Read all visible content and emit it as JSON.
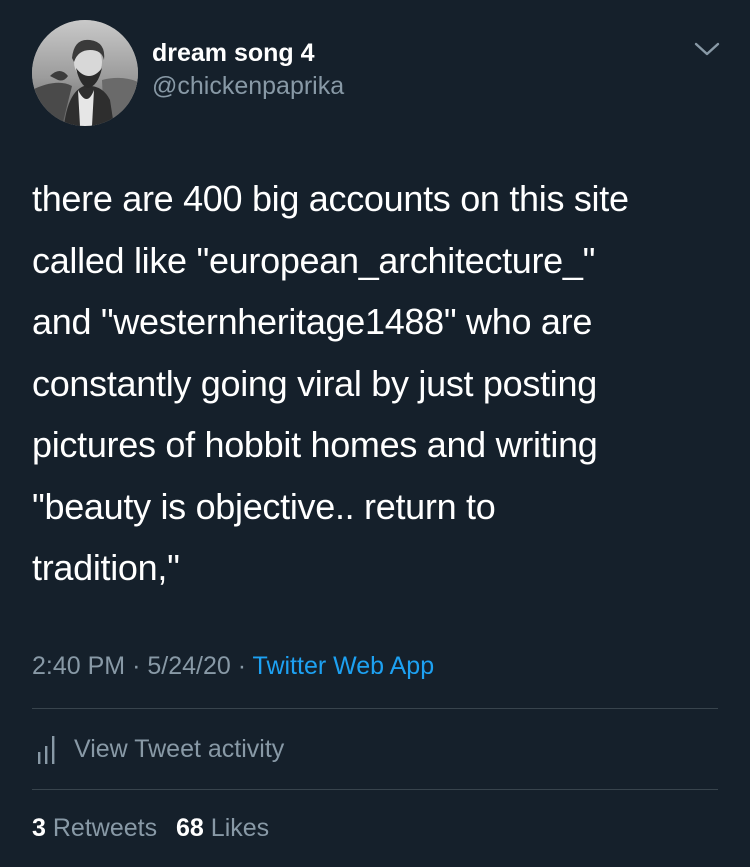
{
  "user": {
    "display_name": "dream song 4",
    "handle": "@chickenpaprika",
    "avatar_icon": "profile-photo"
  },
  "tweet": {
    "text": "there are 400 big accounts on this site\ncalled like \"european_architecture_\"\nand \"westernheritage1488\" who are\nconstantly going viral by just posting\npictures of hobbit homes and writing\n\"beauty is objective.. return to\ntradition,\"",
    "time": "2:40 PM",
    "date": "5/24/20",
    "separator": "·",
    "source": "Twitter Web App"
  },
  "activity": {
    "label": "View Tweet activity",
    "icon": "bar-chart-icon"
  },
  "stats": {
    "retweets_count": "3",
    "retweets_label": "Retweets",
    "likes_count": "68",
    "likes_label": "Likes"
  },
  "colors": {
    "background": "#15202b",
    "primary_text": "#ffffff",
    "secondary_text": "#8899a6",
    "link": "#1da1f2",
    "divider": "#38444d"
  }
}
